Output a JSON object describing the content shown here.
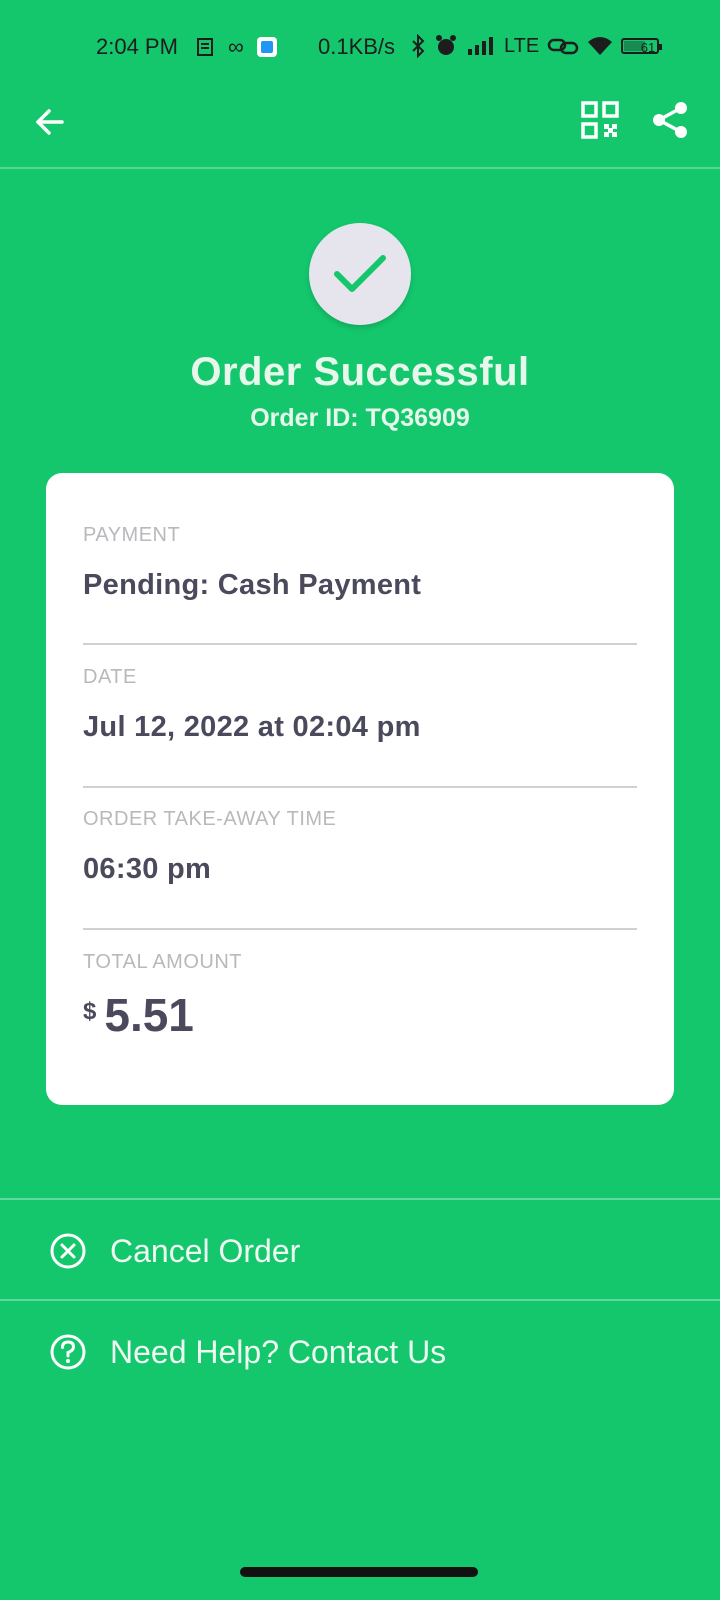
{
  "status_bar": {
    "time": "2:04 PM",
    "speed": "0.1KB/s",
    "network": "LTE",
    "battery": "61"
  },
  "app_bar": {
    "back_icon": "arrow-left-icon",
    "qr_icon": "qr-code-icon",
    "share_icon": "share-icon"
  },
  "header": {
    "title": "Order Successful",
    "order_id": "Order ID: TQ36909"
  },
  "details": {
    "payment_label": "PAYMENT",
    "payment_value": "Pending: Cash Payment",
    "date_label": "DATE",
    "date_value": "Jul 12, 2022 at 02:04 pm",
    "takeaway_label": "ORDER TAKE-AWAY TIME",
    "takeaway_value": "06:30 pm",
    "total_label": "TOTAL AMOUNT",
    "currency": "$",
    "total_value": "5.51"
  },
  "actions": {
    "cancel_label": "Cancel Order",
    "help_label": "Need Help? Contact Us"
  },
  "colors": {
    "background": "#14c76d",
    "card": "#ffffff",
    "text_dark": "#4a4a5c",
    "label_gray": "#b8b8bd"
  }
}
